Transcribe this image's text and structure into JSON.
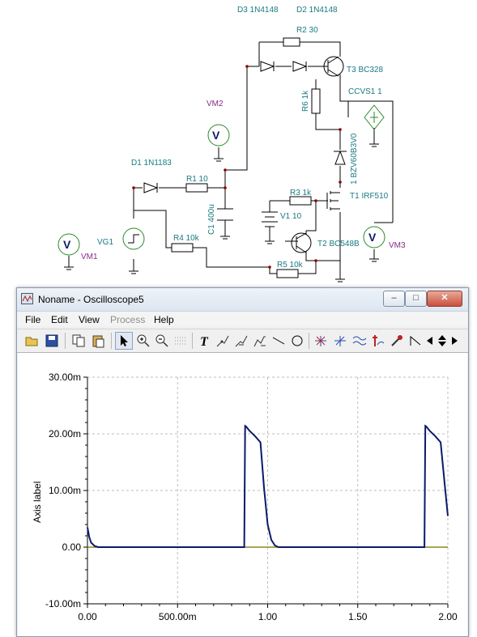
{
  "schematic": {
    "components": {
      "d3": "D3 1N4148",
      "d2": "D2 1N4148",
      "r2": "R2 30",
      "t3": "T3 BC328",
      "r6": "R6 1k",
      "ccvs1": "CCVS1 1",
      "vm2": "VM2",
      "d1": "D1 1N1183",
      "r1": "R1 10",
      "zener": "1 BZV60B3V0",
      "r3": "R3 1k",
      "mosfet": "T1 IRF510",
      "c1": "C1 400u",
      "v1": "V1 10",
      "vg1": "VG1",
      "vm1": "VM1",
      "r4": "R4 10k",
      "t2": "T2 BC548B",
      "vm3": "VM3",
      "r5": "R5 10k"
    },
    "meter_symbol": "V",
    "wire_color": "#000000",
    "label_color": "#1a7a80",
    "meter_color": "#2a8a2a"
  },
  "window": {
    "title": "Noname - Oscilloscope5",
    "minimize_label": "–",
    "maximize_label": "□",
    "close_label": "✕"
  },
  "menu": {
    "items": [
      {
        "label": "File"
      },
      {
        "label": "Edit"
      },
      {
        "label": "View"
      },
      {
        "label": "Process",
        "disabled": true
      },
      {
        "label": "Help"
      }
    ]
  },
  "toolbar": {
    "icons": [
      "open-icon",
      "save-icon",
      "copy-icon",
      "paste-icon",
      "pointer-icon",
      "zoom-in-icon",
      "zoom-out-icon",
      "grid-icon",
      "text-icon",
      "cursor-a-icon",
      "cursor-b-icon",
      "cursor-c-icon",
      "line-icon",
      "circle-icon",
      "marker-a-icon",
      "marker-b-icon",
      "waveform-icon",
      "add-marker-icon",
      "probe-icon",
      "ramp-icon",
      "scroll-left-icon",
      "scroll-updown-icon",
      "scroll-right-icon"
    ]
  },
  "chart_data": {
    "type": "line",
    "title": "",
    "xlabel": "",
    "ylabel": "Axis label",
    "xlim": [
      0,
      2.0
    ],
    "ylim": [
      -0.01,
      0.03
    ],
    "x_ticks": [
      "0.00",
      "500.00m",
      "1.00",
      "1.50",
      "2.00"
    ],
    "y_ticks": [
      "30.00m",
      "20.00m",
      "10.00m",
      "0.00",
      "-10.00m"
    ],
    "grid": true,
    "series": [
      {
        "color": "#0a1a6a",
        "x": [
          0.0,
          0.01,
          0.02,
          0.04,
          0.06,
          0.08,
          0.12,
          0.5,
          0.87,
          0.875,
          0.88,
          0.9,
          0.93,
          0.96,
          0.98,
          1.0,
          1.02,
          1.04,
          1.06,
          1.1,
          1.5,
          1.87,
          1.875,
          1.88,
          1.9,
          1.93,
          1.96,
          1.98,
          2.0
        ],
        "y": [
          0.0035,
          0.0018,
          0.0008,
          0.0002,
          0.0,
          0.0,
          0.0,
          0.0,
          0.0,
          0.0214,
          0.0213,
          0.0205,
          0.0196,
          0.0185,
          0.0105,
          0.004,
          0.0013,
          0.0003,
          0.0,
          0.0,
          0.0,
          0.0,
          0.0214,
          0.0213,
          0.0205,
          0.0196,
          0.0185,
          0.012,
          0.0055
        ]
      },
      {
        "color": "#8a8a1a",
        "x": [
          0.0,
          2.0
        ],
        "y": [
          0.0,
          0.0
        ]
      }
    ]
  }
}
